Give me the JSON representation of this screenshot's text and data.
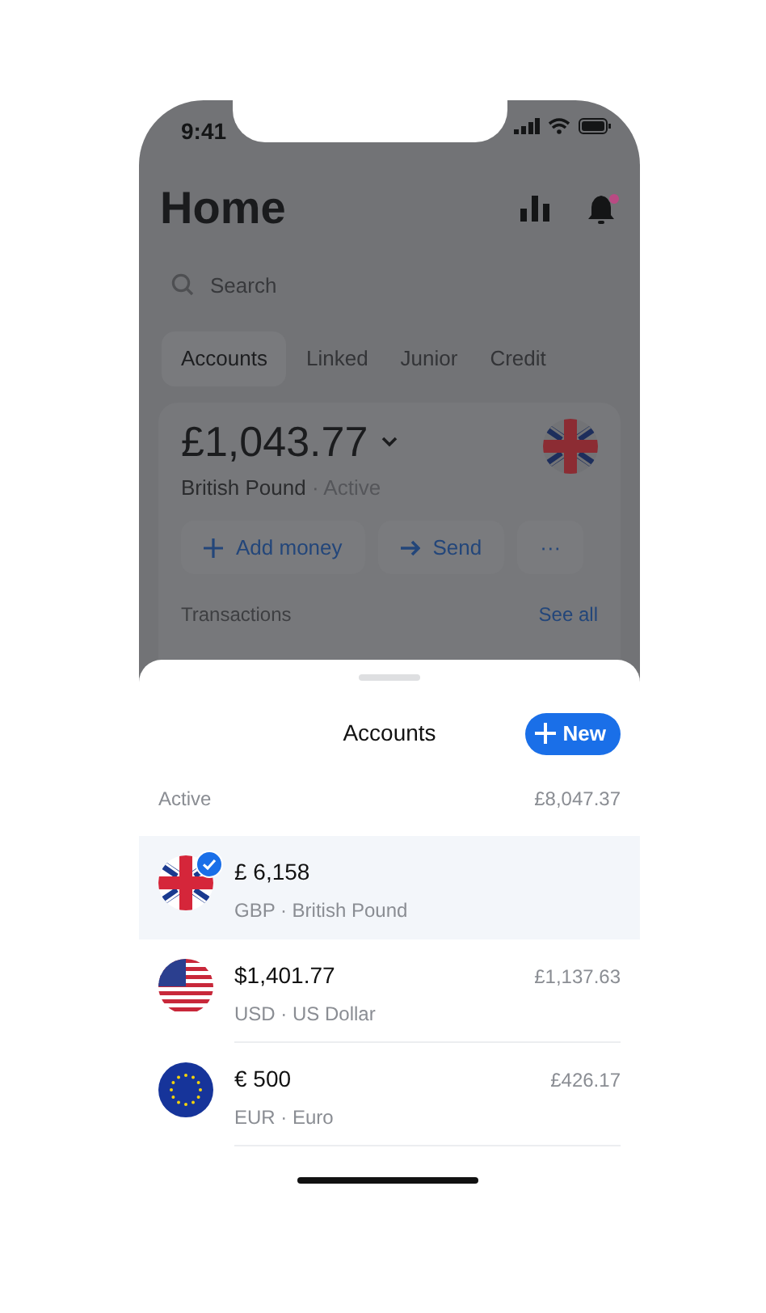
{
  "status_bar": {
    "time": "9:41"
  },
  "header": {
    "title": "Home",
    "bell_unread": true
  },
  "search": {
    "placeholder": "Search"
  },
  "tabs": [
    {
      "label": "Accounts",
      "selected": true
    },
    {
      "label": "Linked",
      "selected": false
    },
    {
      "label": "Junior",
      "selected": false
    },
    {
      "label": "Credit",
      "selected": false
    }
  ],
  "balance_card": {
    "amount": "£1,043.77",
    "currency": "British Pound",
    "status": "· Active",
    "kind": "uk",
    "actions": [
      {
        "kind": "plus",
        "label": "Add money"
      },
      {
        "kind": "arrow",
        "label": "Send"
      },
      {
        "kind": "more",
        "label": "···"
      }
    ],
    "transactions_label": "Transactions",
    "see_all": "See all"
  },
  "sheet": {
    "title": "Accounts",
    "new_button": "New",
    "section_label": "Active",
    "section_total": "£8,047.37",
    "accounts": [
      {
        "kind": "uk",
        "amount": "£ 6,158",
        "subtitle": "GBP · British Pound",
        "selected": true
      },
      {
        "kind": "us",
        "amount": "$1,401.77",
        "subtitle": "USD · US Dollar",
        "converted": "£1,137.63",
        "selected": false
      },
      {
        "kind": "eu",
        "amount": "€ 500",
        "subtitle": "EUR · Euro",
        "converted": "£426.17",
        "selected": false
      }
    ]
  }
}
